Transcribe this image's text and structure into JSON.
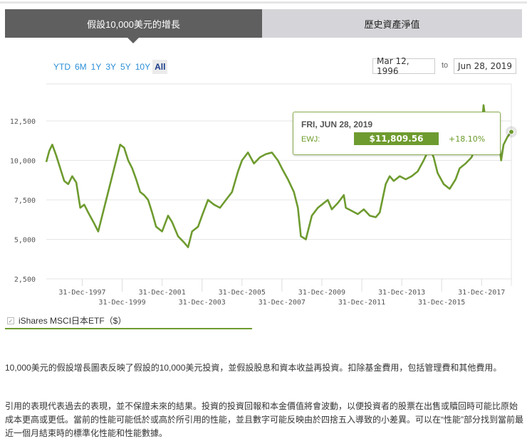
{
  "tabs": [
    {
      "label": "假設10,000美元的增長",
      "active": true
    },
    {
      "label": "歷史資產淨值",
      "active": false
    }
  ],
  "ranges": [
    "YTD",
    "6M",
    "1Y",
    "3Y",
    "5Y",
    "10Y",
    "All"
  ],
  "active_range": "All",
  "date_from": "Mar 12, 1996",
  "date_to_label": "to",
  "date_to": "Jun 28, 2019",
  "tooltip": {
    "date": "FRI, JUN 28, 2019",
    "label": "EWJ:",
    "value": "$11,809.56",
    "change": "+18.10%"
  },
  "legend": {
    "label": "iShares MSCI日本ETF（$）",
    "checked": true
  },
  "colors": {
    "series": "#6e9b2f",
    "tab_active": "#5f5f5f",
    "tab_inactive": "#d5d5d9",
    "link": "#2a8fd8"
  },
  "paragraphs": [
    "10,000美元的假設增長圖表反映了假設的10,000美元投資，並假設股息和資本收益再投資。扣除基金費用，包括管理費和其他費用。",
    "引用的表現代表過去的表現，並不保證未來的結果。投資的投資回報和本金價值將會波動，以便投資者的股票在出售或贖回時可能比原始成本更高或更低。當前的性能可能低於或高於所引用的性能，並且數字可能反映由於四捨五入導致的小差異。可以在“性能”部分找到當前最近一個月結束時的標準化性能和性能數據。"
  ],
  "chart_data": {
    "type": "line",
    "title": "",
    "xlabel": "",
    "ylabel": "",
    "ylim": [
      2500,
      13500
    ],
    "xlim": [
      1996.2,
      2019.49
    ],
    "yticks": [
      {
        "v": 2500,
        "label": "2,500"
      },
      {
        "v": 5000,
        "label": "5,000"
      },
      {
        "v": 7500,
        "label": "7,500"
      },
      {
        "v": 10000,
        "label": "10,000"
      },
      {
        "v": 12500,
        "label": "12,500"
      }
    ],
    "xticks": [
      {
        "t": 1998.0,
        "label": "31-Dec-1997",
        "row": 0
      },
      {
        "t": 2000.0,
        "label": "31-Dec-1999",
        "row": 1
      },
      {
        "t": 2002.0,
        "label": "31-Dec-2001",
        "row": 0
      },
      {
        "t": 2004.0,
        "label": "31-Dec-2003",
        "row": 1
      },
      {
        "t": 2006.0,
        "label": "31-Dec-2005",
        "row": 0
      },
      {
        "t": 2008.0,
        "label": "31-Dec-2007",
        "row": 1
      },
      {
        "t": 2010.0,
        "label": "31-Dec-2009",
        "row": 0
      },
      {
        "t": 2012.0,
        "label": "31-Dec-2011",
        "row": 1
      },
      {
        "t": 2014.0,
        "label": "31-Dec-2013",
        "row": 0
      },
      {
        "t": 2016.0,
        "label": "31-Dec-2015",
        "row": 1
      },
      {
        "t": 2018.0,
        "label": "31-Dec-2017",
        "row": 0
      }
    ],
    "series": [
      {
        "name": "iShares MSCI日本ETF（$）",
        "x": [
          1996.2,
          1996.35,
          1996.5,
          1996.7,
          1996.9,
          1997.1,
          1997.3,
          1997.5,
          1997.7,
          1997.9,
          1998.1,
          1998.3,
          1998.6,
          1998.8,
          1999.0,
          1999.2,
          1999.5,
          1999.7,
          1999.9,
          2000.1,
          2000.3,
          2000.5,
          2000.7,
          2000.9,
          2001.1,
          2001.3,
          2001.5,
          2001.7,
          2002.0,
          2002.3,
          2002.5,
          2002.8,
          2003.1,
          2003.3,
          2003.5,
          2003.8,
          2004.0,
          2004.3,
          2004.6,
          2004.9,
          2005.2,
          2005.5,
          2005.8,
          2006.0,
          2006.3,
          2006.6,
          2006.9,
          2007.2,
          2007.5,
          2007.8,
          2008.0,
          2008.3,
          2008.6,
          2008.8,
          2008.95,
          2009.2,
          2009.5,
          2009.8,
          2010.0,
          2010.3,
          2010.5,
          2010.8,
          2011.1,
          2011.2,
          2011.5,
          2011.8,
          2012.1,
          2012.4,
          2012.7,
          2012.9,
          2013.2,
          2013.4,
          2013.6,
          2013.9,
          2014.2,
          2014.5,
          2014.8,
          2015.1,
          2015.4,
          2015.6,
          2015.8,
          2016.1,
          2016.4,
          2016.7,
          2016.9,
          2017.2,
          2017.5,
          2017.8,
          2018.0,
          2018.1,
          2018.3,
          2018.6,
          2018.8,
          2018.98,
          2019.1,
          2019.3,
          2019.49
        ],
        "y": [
          9900,
          10600,
          11000,
          10300,
          9500,
          8700,
          8500,
          9000,
          8600,
          7000,
          7200,
          6700,
          6000,
          5500,
          6500,
          7500,
          9000,
          10000,
          11000,
          10800,
          10000,
          9500,
          8800,
          8000,
          7800,
          7500,
          6700,
          5800,
          5500,
          6500,
          6100,
          5200,
          4800,
          4500,
          5500,
          5800,
          6500,
          7500,
          7200,
          7000,
          7500,
          8000,
          9300,
          10000,
          10500,
          9800,
          10200,
          10400,
          10500,
          10000,
          9500,
          8800,
          8000,
          7000,
          5200,
          5000,
          6500,
          7000,
          7200,
          7500,
          6900,
          7300,
          7800,
          7000,
          6800,
          6600,
          6900,
          6500,
          6400,
          6700,
          8500,
          9000,
          8700,
          9000,
          8800,
          9000,
          9300,
          10000,
          10800,
          10200,
          9200,
          8500,
          8200,
          8800,
          9500,
          9800,
          10200,
          11200,
          12000,
          13500,
          11500,
          11200,
          11800,
          10000,
          11000,
          11500,
          11809.56
        ]
      }
    ]
  }
}
